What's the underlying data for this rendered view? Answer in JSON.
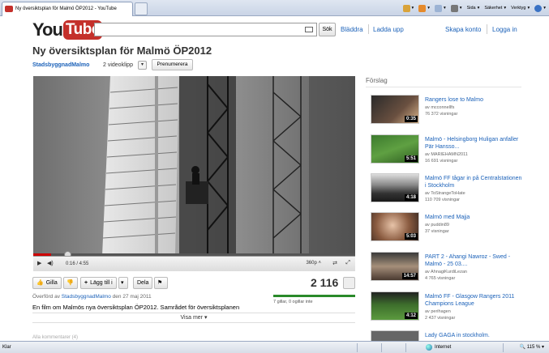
{
  "browser": {
    "tab_title": "Ny översiktsplan för Malmö ÖP2012 - YouTube",
    "commands": {
      "page": "Sida",
      "safety": "Säkerhet",
      "tools": "Verktyg"
    },
    "status_text": "Klar",
    "zone": "Internet",
    "zoom": "115 %"
  },
  "header": {
    "logo_you": "You",
    "logo_tube": "Tube",
    "search_button": "Sök",
    "browse": "Bläddra",
    "upload": "Ladda upp",
    "create_account": "Skapa konto",
    "login": "Logga in"
  },
  "video": {
    "title": "Ny översiktsplan för Malmö ÖP2012",
    "channel": "StadsbyggnadMalmo",
    "video_count": "2 videoklipp",
    "subscribe": "Prenumerera",
    "time": "0:16 / 4:55",
    "progress": 0.056,
    "quality": "360p",
    "views": "2 116",
    "likes_text": "7 gillar, 0 ogillar inte",
    "like_ratio": 1.0,
    "uploaded_prefix": "Överförd av",
    "uploaded_by": "StadsbyggnadMalmo",
    "uploaded_date": "den 27 maj 2011",
    "description": "En film om Malmös nya översiktsplan ÖP2012. Samrådet för översiktsplanen",
    "show_more": "Visa mer",
    "comments_hint": "Alla kommentarer (4)"
  },
  "actions": {
    "like": "Gilla",
    "add_to": "Lägg till i",
    "share": "Dela"
  },
  "sidebar": {
    "title": "Förslag",
    "items": [
      {
        "title": "Rangers lose to Malmo",
        "by": "av mcconnellfs",
        "views": "76 372 visningar",
        "duration": "0:35"
      },
      {
        "title": "Malmö - Helsingborg Huligan anfaller Pär Hansso...",
        "by": "av MARIEHAMN2011",
        "views": "16 691 visningar",
        "duration": "5:51"
      },
      {
        "title": "Malmö FF tågar in på Centralstationen i Stockholm",
        "by": "av ToStrangeToHate",
        "views": "110 709 visningar",
        "duration": "4:18"
      },
      {
        "title": "Malmö med Majja",
        "by": "av puddin89",
        "views": "37 visningar",
        "duration": "5:03"
      },
      {
        "title": "PART 2 - Ahangi Nawroz - Swed - Malmö - 25 03....",
        "by": "av AhnagiKurdiLezan",
        "views": "4 765 visningar",
        "duration": "14:57"
      },
      {
        "title": "Malmö FF - Glasgow Rangers 2011 Champions League",
        "by": "av perihagen",
        "views": "2 437 visningar",
        "duration": "4:12"
      },
      {
        "title": "Lady GAGA in stockholm.",
        "by": "",
        "views": "",
        "duration": ""
      }
    ]
  }
}
